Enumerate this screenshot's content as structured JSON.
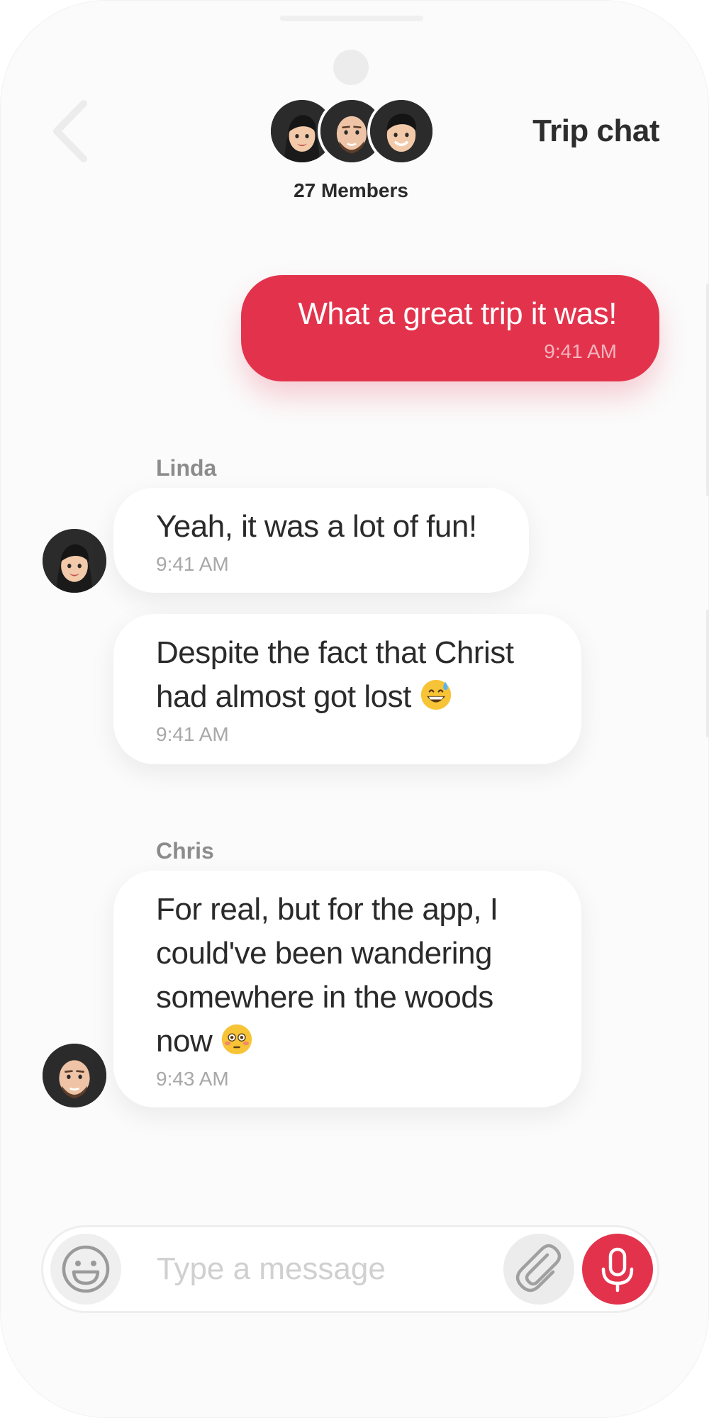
{
  "header": {
    "title": "Trip chat",
    "members_label": "27 Members",
    "avatars": [
      "linda-avatar",
      "chris-avatar",
      "member-avatar"
    ]
  },
  "messages": [
    {
      "direction": "outgoing",
      "text": "What a great trip it was!",
      "time": "9:41 AM"
    },
    {
      "direction": "incoming",
      "sender": "Linda",
      "text": "Yeah, it was a lot of fun!",
      "time": "9:41 AM"
    },
    {
      "direction": "incoming",
      "sender": "Linda",
      "text_line1": "Despite the fact that Christ",
      "text_line2": "had almost got lost",
      "emoji": "grinning-sweat-emoji",
      "time": "9:41 AM"
    },
    {
      "direction": "incoming",
      "sender": "Chris",
      "text_line1": "For real, but for the app, I",
      "text_line2": "could've been wandering",
      "text_line3": "somewhere in the woods",
      "text_line4": "now",
      "emoji": "flushed-face-emoji",
      "time": "9:43 AM"
    }
  ],
  "composer": {
    "placeholder": "Type a message",
    "value": "",
    "icons": [
      "smiley-icon",
      "paperclip-icon",
      "microphone-icon"
    ]
  },
  "colors": {
    "accent": "#e3334c",
    "background": "#fbfbfb",
    "bubble_incoming": "#ffffff",
    "text_primary": "#2a2a2a",
    "text_muted": "#a8a8a8"
  }
}
